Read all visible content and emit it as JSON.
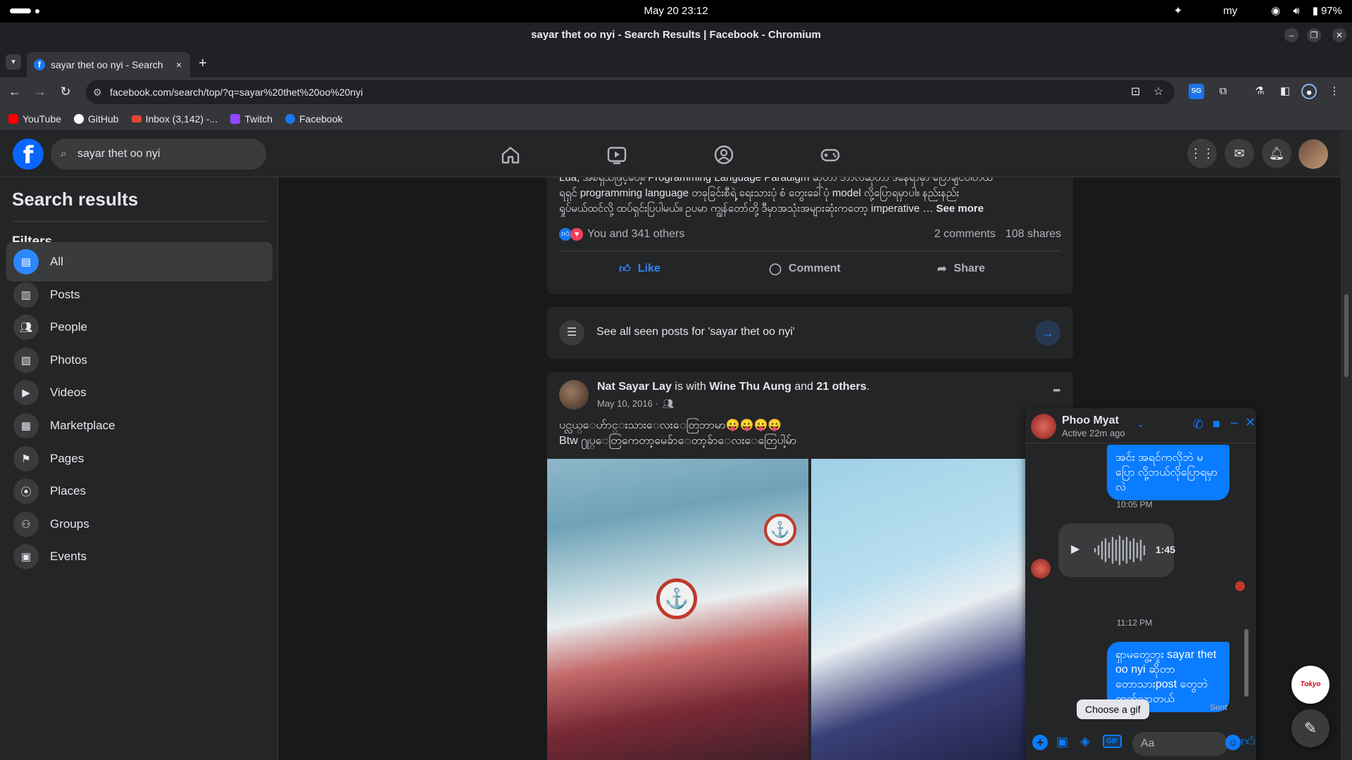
{
  "os": {
    "datetime": "May 20  23:12",
    "keyboard": "my",
    "battery": "97%"
  },
  "window": {
    "title": "sayar thet oo nyi - Search Results | Facebook - Chromium"
  },
  "tab": {
    "title": "sayar thet oo nyi - Search",
    "close": "×",
    "new_tab": "+"
  },
  "address": {
    "url": "facebook.com/search/top/?q=sayar%20thet%20oo%20nyi"
  },
  "bookmarks": [
    {
      "label": "YouTube",
      "color": "#ff0000"
    },
    {
      "label": "GitHub",
      "color": "#ffffff"
    },
    {
      "label": "Inbox (3,142) -...",
      "color": "#ea4335"
    },
    {
      "label": "Twitch",
      "color": "#9146ff"
    },
    {
      "label": "Facebook",
      "color": "#1877f2"
    }
  ],
  "fb": {
    "logo": "f",
    "search_value": "sayar thet oo nyi",
    "accent": "#0866ff"
  },
  "sidebar": {
    "title": "Search results",
    "filters_heading": "Filters",
    "items": [
      {
        "label": "All",
        "icon": "all-icon",
        "active": true
      },
      {
        "label": "Posts",
        "icon": "posts-icon"
      },
      {
        "label": "People",
        "icon": "people-icon"
      },
      {
        "label": "Photos",
        "icon": "photos-icon"
      },
      {
        "label": "Videos",
        "icon": "videos-icon"
      },
      {
        "label": "Marketplace",
        "icon": "marketplace-icon"
      },
      {
        "label": "Pages",
        "icon": "pages-icon"
      },
      {
        "label": "Places",
        "icon": "places-icon"
      },
      {
        "label": "Groups",
        "icon": "groups-icon"
      },
      {
        "label": "Events",
        "icon": "events-icon"
      }
    ]
  },
  "post1": {
    "text_line1": "Lua, အစရှိသဖြင့်ပေါ့။ Programming Language Paradigm ဆိုတာ ဘာလဲဆိုတာ ဒီနေရာမှာ ပြောချင်ပါတယ်",
    "text_line2": "ရရှင် programming language တခုခြင်းစီရဲ့ ရေးသားပုံ စံ တွေးခေါ်ပုံ model လို့ပြောရမှာပါ။ နည်းနည်း",
    "text_line3": "ရှုပ်မယ်ထင်လို့ ထပ်ရှင်းပြပါမယ်။ ဥပမာ ကျွန်တော်တို့ ဒီမှာအသုံးအများဆုံးကတော့ imperative …",
    "see_more": "See more",
    "reactions": "You and 341 others",
    "comments": "2 comments",
    "shares": "108 shares",
    "like": "Like",
    "comment": "Comment",
    "share": "Share"
  },
  "seen_posts": {
    "label": "See all seen posts for 'sayar thet oo nyi'"
  },
  "post2": {
    "author": "Nat Sayar Lay",
    "is_with": "is with",
    "tagged": "Wine Thu Aung",
    "and": "and",
    "others": "21 others",
    "date": "May 10, 2016 ·",
    "line1": "ပင္လယ္ေဟ်ာင္းသားေလးေတြဘာမာ😛😛😛😛",
    "line2": "Btw ႐ုပ္ေတြကေတာ့မေခ်ာေတာ့ခ်ာေလးေတြေပါ့မ်ာ",
    "more": "•••"
  },
  "chat": {
    "name": "Phoo Myat",
    "status": "Active 22m ago",
    "msg1": "အင်း အရင်ကလိုဘဲ မပြော လို့ဘယ်လိုပြောရမှာလဲ",
    "time1": "10:05 PM",
    "audio_duration": "1:45",
    "time2": "11:12 PM",
    "msg2": "ရှာမတွေ့ဘူး sayar thet oo nyi ဆိုတာ တောသားpost တွေဘဲတက်လာတယ်",
    "sent": "Sent",
    "tooltip": "Choose a gif",
    "input_placeholder": "Aa",
    "gif": "GIF"
  },
  "floating": {
    "badge": "Tokyo Style"
  }
}
